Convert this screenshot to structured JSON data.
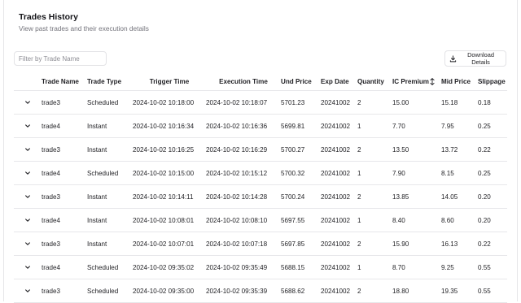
{
  "header": {
    "title": "Trades History",
    "subtitle": "View past trades and their execution details"
  },
  "filter": {
    "placeholder": "Filter by Trade Name",
    "value": ""
  },
  "download_button": {
    "label": "Download Details",
    "icon": "download-icon"
  },
  "table": {
    "columns": [
      "Trade Name",
      "Trade Type",
      "Trigger Time",
      "Execution Time",
      "Und Price",
      "Exp Date",
      "Quantity",
      "IC Premium",
      "Mid Price",
      "Slippage"
    ],
    "sort_column_icon": "sort-arrows-icon",
    "row_expand_icon": "chevron-down-icon",
    "rows": [
      [
        "trade3",
        "Scheduled",
        "2024-10-02 10:18:00",
        "2024-10-02 10:18:07",
        "5701.23",
        "20241002",
        "2",
        "15.00",
        "15.18",
        "0.18"
      ],
      [
        "trade4",
        "Instant",
        "2024-10-02 10:16:34",
        "2024-10-02 10:16:36",
        "5699.81",
        "20241002",
        "1",
        "7.70",
        "7.95",
        "0.25"
      ],
      [
        "trade3",
        "Instant",
        "2024-10-02 10:16:25",
        "2024-10-02 10:16:29",
        "5700.27",
        "20241002",
        "2",
        "13.50",
        "13.72",
        "0.22"
      ],
      [
        "trade4",
        "Scheduled",
        "2024-10-02 10:15:00",
        "2024-10-02 10:15:12",
        "5700.32",
        "20241002",
        "1",
        "7.90",
        "8.15",
        "0.25"
      ],
      [
        "trade3",
        "Instant",
        "2024-10-02 10:14:11",
        "2024-10-02 10:14:28",
        "5700.24",
        "20241002",
        "2",
        "13.85",
        "14.05",
        "0.20"
      ],
      [
        "trade4",
        "Instant",
        "2024-10-02 10:08:01",
        "2024-10-02 10:08:10",
        "5697.55",
        "20241002",
        "1",
        "8.40",
        "8.60",
        "0.20"
      ],
      [
        "trade3",
        "Instant",
        "2024-10-02 10:07:01",
        "2024-10-02 10:07:18",
        "5697.85",
        "20241002",
        "2",
        "15.90",
        "16.13",
        "0.22"
      ],
      [
        "trade4",
        "Scheduled",
        "2024-10-02 09:35:02",
        "2024-10-02 09:35:49",
        "5688.15",
        "20241002",
        "1",
        "8.70",
        "9.25",
        "0.55"
      ],
      [
        "trade3",
        "Scheduled",
        "2024-10-02 09:35:00",
        "2024-10-02 09:35:39",
        "5688.62",
        "20241002",
        "2",
        "18.80",
        "19.35",
        "0.55"
      ]
    ]
  }
}
